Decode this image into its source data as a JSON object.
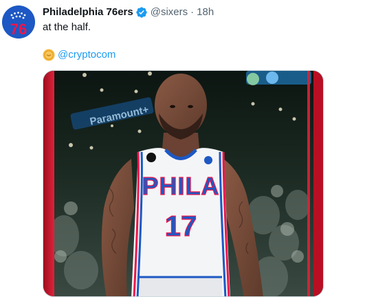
{
  "tweet": {
    "author": {
      "display_name": "Philadelphia 76ers",
      "handle": "@sixers",
      "verified": true
    },
    "separator": "·",
    "time": "18h",
    "text": "at the half.",
    "mention": {
      "icon": "crypto-coin-icon",
      "text": "@cryptocom"
    },
    "avatar": {
      "logo_text": "76",
      "icon": "sixers-logo-icon"
    },
    "media": {
      "description": "Photo of a 76ers player wearing a white PHILA #17 jersey at an arena",
      "jersey": {
        "wordmark": "PHILA",
        "number": "17"
      },
      "banner_text": "Paramount+"
    }
  },
  "colors": {
    "link": "#1d9bf0",
    "muted": "#536471",
    "verified": "#1d9bf0",
    "sixers_blue": "#1d58c4",
    "sixers_red": "#ed174c",
    "frame_red": "#c8102e"
  }
}
